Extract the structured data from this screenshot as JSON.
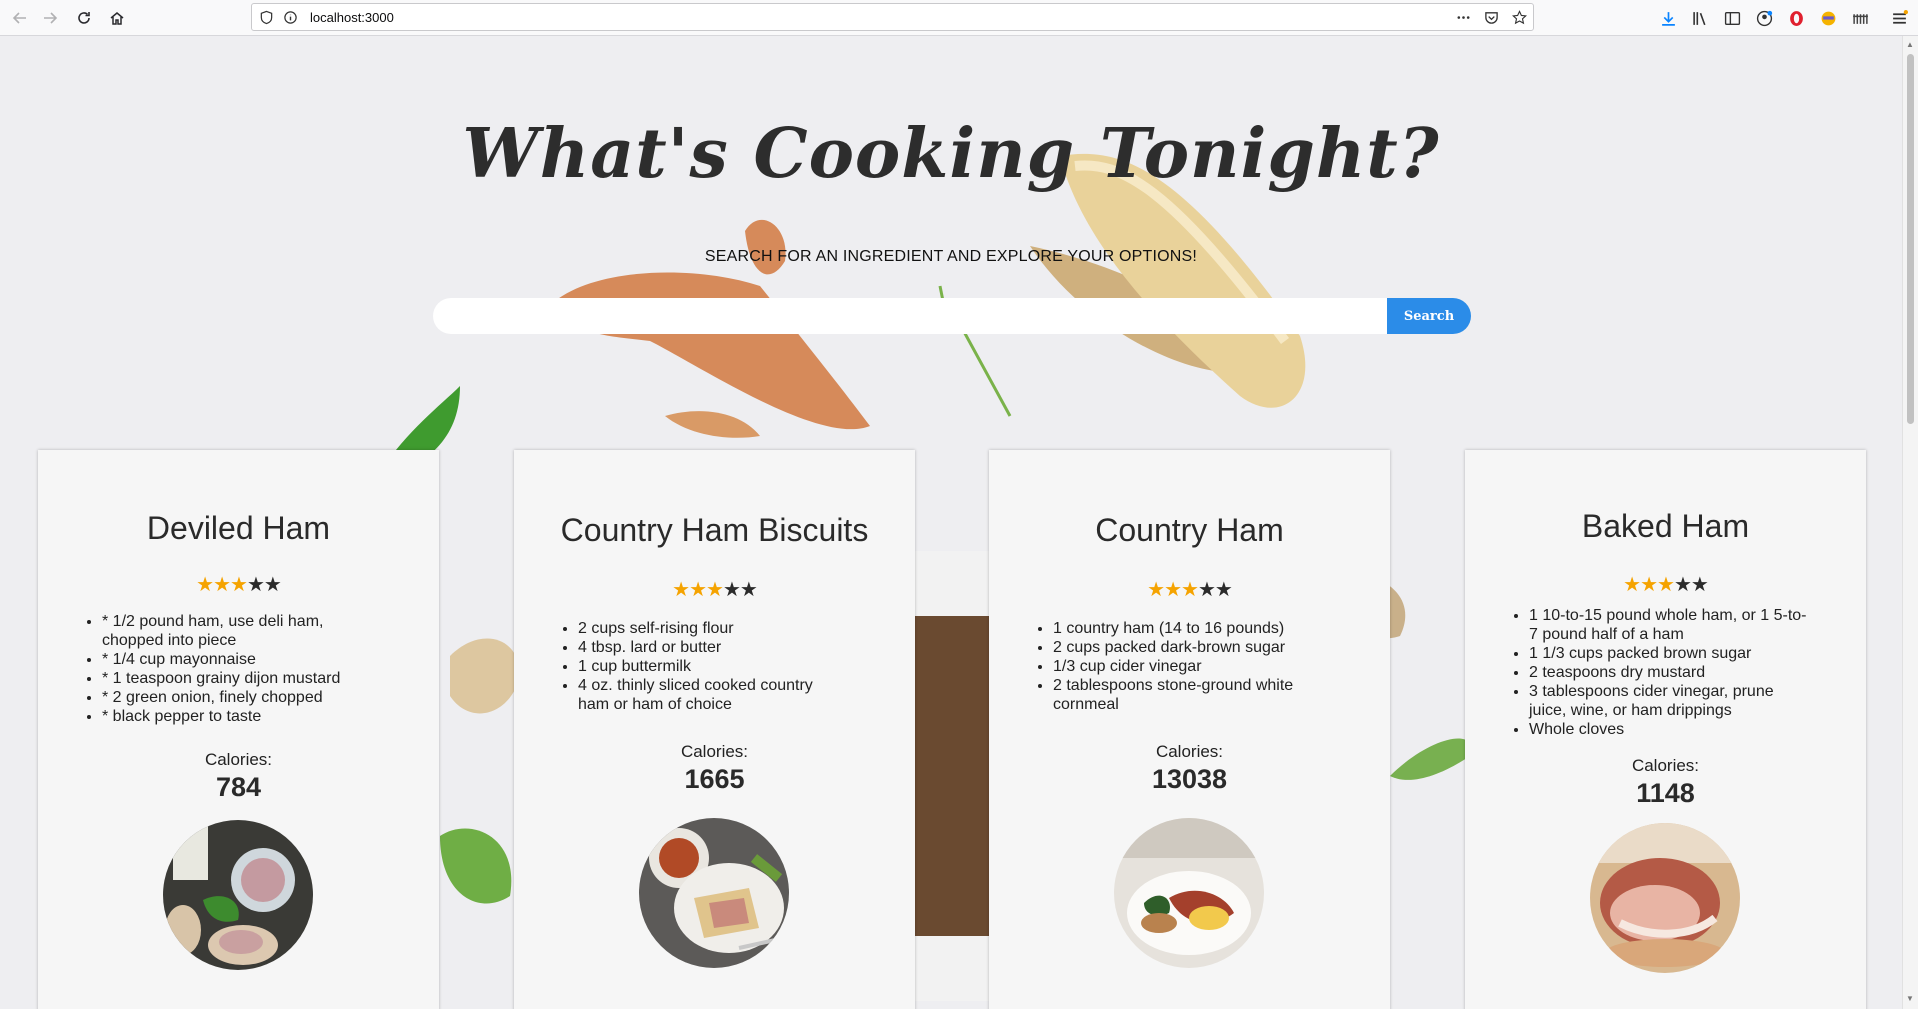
{
  "browser": {
    "url": "localhost:3000"
  },
  "hero": {
    "title": "What's Cooking Tonight?",
    "subtitle": "SEARCH FOR AN INGREDIENT AND EXPLORE YOUR OPTIONS!",
    "search_value": "",
    "search_placeholder": "",
    "search_button": "Search"
  },
  "cards": [
    {
      "title": "Deviled Ham",
      "rating": 3,
      "rating_max": 5,
      "ingredients": [
        "* 1/2 pound ham, use deli ham, chopped into piece",
        "* 1/4 cup mayonnaise",
        "* 1 teaspoon grainy dijon mustard",
        "* 2 green onion, finely chopped",
        "* black pepper to taste"
      ],
      "calories_label": "Calories:",
      "calories": "784"
    },
    {
      "title": "Country Ham Biscuits",
      "rating": 3,
      "rating_max": 5,
      "ingredients": [
        "2 cups self-rising flour",
        "4 tbsp. lard or butter",
        "1 cup buttermilk",
        "4 oz. thinly sliced cooked country ham or ham of choice"
      ],
      "calories_label": "Calories:",
      "calories": "1665"
    },
    {
      "title": "Country Ham",
      "rating": 3,
      "rating_max": 5,
      "ingredients": [
        "1 country ham (14 to 16 pounds)",
        "2 cups packed dark-brown sugar",
        "1/3 cup cider vinegar",
        "2 tablespoons stone-ground white cornmeal"
      ],
      "calories_label": "Calories:",
      "calories": "13038"
    },
    {
      "title": "Baked Ham",
      "rating": 3,
      "rating_max": 5,
      "ingredients": [
        "1 10-to-15 pound whole ham, or 1 5-to-7 pound half of a ham",
        "1 1/3 cups packed brown sugar",
        "2 teaspoons dry mustard",
        "3 tablespoons cider vinegar, prune juice, wine, or ham drippings",
        "Whole cloves"
      ],
      "calories_label": "Calories:",
      "calories": "1148"
    }
  ],
  "colors": {
    "accent": "#2b8ce8",
    "star_filled": "#f5a300",
    "star_empty": "#2b2b2b"
  }
}
